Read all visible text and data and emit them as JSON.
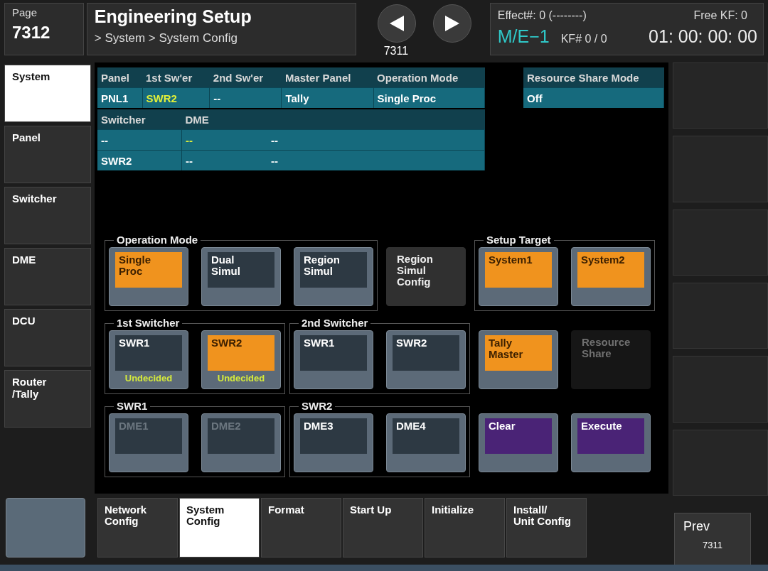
{
  "header": {
    "page_label": "Page",
    "page_number": "7312",
    "title": "Engineering Setup",
    "breadcrumb": "> System > System Config",
    "nav_page": "7311",
    "effect": "Effect#: 0 (--------)",
    "free_kf": "Free KF: 0",
    "me": "M/E−1",
    "kf": "KF# 0 / 0",
    "timecode": "01: 00: 00: 00"
  },
  "sidebar": {
    "items": [
      {
        "label": "System",
        "selected": true
      },
      {
        "label": "Panel",
        "selected": false
      },
      {
        "label": "Switcher",
        "selected": false
      },
      {
        "label": "DME",
        "selected": false
      },
      {
        "label": "DCU",
        "selected": false
      },
      {
        "label": "Router\n/Tally",
        "selected": false
      }
    ]
  },
  "status_table": {
    "columns": [
      "Panel",
      "1st Sw'er",
      "2nd Sw'er",
      "Master Panel",
      "Operation Mode"
    ],
    "rows": [
      [
        {
          "text": "PNL1",
          "highlight": false
        },
        {
          "text": "SWR2",
          "highlight": true
        },
        {
          "text": "--",
          "highlight": false
        },
        {
          "text": "Tally",
          "highlight": false
        },
        {
          "text": "Single Proc",
          "highlight": false
        }
      ]
    ]
  },
  "resource_table": {
    "columns": [
      "Resource Share Mode"
    ],
    "rows": [
      [
        {
          "text": "Off",
          "highlight": false
        }
      ]
    ]
  },
  "dme_table": {
    "columns": [
      "Switcher",
      "DME"
    ],
    "rows": [
      {
        "switcher": "--",
        "dme": [
          {
            "text": "--",
            "highlight": true
          },
          {
            "text": "--",
            "highlight": false
          }
        ]
      },
      {
        "switcher": "SWR2",
        "dme": [
          {
            "text": "--",
            "highlight": false
          },
          {
            "text": "--",
            "highlight": false
          }
        ]
      }
    ]
  },
  "panel_rows": [
    [
      {
        "title": "Operation Mode",
        "buttons": [
          {
            "label": "Single\nProc",
            "kind": "toggle",
            "selected": true,
            "disabled": false
          },
          {
            "label": "Dual\nSimul",
            "kind": "toggle",
            "selected": false,
            "disabled": false
          },
          {
            "label": "Region\nSimul",
            "kind": "toggle",
            "selected": false,
            "disabled": false
          }
        ]
      },
      {
        "buttons": [
          {
            "label": "Region\nSimul\nConfig",
            "kind": "flat",
            "selected": false,
            "disabled": false
          }
        ]
      },
      {
        "title": "Setup Target",
        "buttons": [
          {
            "label": "System1",
            "kind": "toggle",
            "selected": true,
            "disabled": false
          },
          {
            "label": "System2",
            "kind": "toggle",
            "selected": true,
            "disabled": false
          }
        ]
      }
    ],
    [
      {
        "title": "1st Switcher",
        "buttons": [
          {
            "label": "SWR1",
            "note": "Undecided",
            "kind": "toggle",
            "selected": false,
            "disabled": false
          },
          {
            "label": "SWR2",
            "note": "Undecided",
            "kind": "toggle",
            "selected": true,
            "disabled": false
          }
        ]
      },
      {
        "title": "2nd Switcher",
        "buttons": [
          {
            "label": "SWR1",
            "kind": "toggle",
            "selected": false,
            "disabled": false
          },
          {
            "label": "SWR2",
            "kind": "toggle",
            "selected": false,
            "disabled": false
          }
        ]
      },
      {
        "buttons": [
          {
            "label": "Tally\nMaster",
            "kind": "toggle",
            "selected": true,
            "disabled": false
          }
        ]
      },
      {
        "buttons": [
          {
            "label": "Resource\nShare",
            "kind": "flat",
            "selected": false,
            "disabled": true
          }
        ]
      }
    ],
    [
      {
        "title": "SWR1",
        "buttons": [
          {
            "label": "DME1",
            "kind": "toggle",
            "selected": false,
            "disabled": true
          },
          {
            "label": "DME2",
            "kind": "toggle",
            "selected": false,
            "disabled": true
          }
        ]
      },
      {
        "title": "SWR2",
        "buttons": [
          {
            "label": "DME3",
            "kind": "toggle",
            "selected": false,
            "disabled": false
          },
          {
            "label": "DME4",
            "kind": "toggle",
            "selected": false,
            "disabled": false
          }
        ]
      },
      {
        "buttons": [
          {
            "label": "Clear",
            "kind": "action",
            "selected": false,
            "disabled": false
          }
        ]
      },
      {
        "buttons": [
          {
            "label": "Execute",
            "kind": "action",
            "selected": false,
            "disabled": false
          }
        ]
      }
    ]
  ],
  "tabs": [
    {
      "label": "Network\nConfig",
      "selected": false
    },
    {
      "label": "System\nConfig",
      "selected": true
    },
    {
      "label": "Format",
      "selected": false
    },
    {
      "label": "Start Up",
      "selected": false
    },
    {
      "label": "Initialize",
      "selected": false
    },
    {
      "label": "Install/\nUnit Config",
      "selected": false
    }
  ],
  "prev_button": {
    "label": "Prev",
    "page": "7311"
  }
}
